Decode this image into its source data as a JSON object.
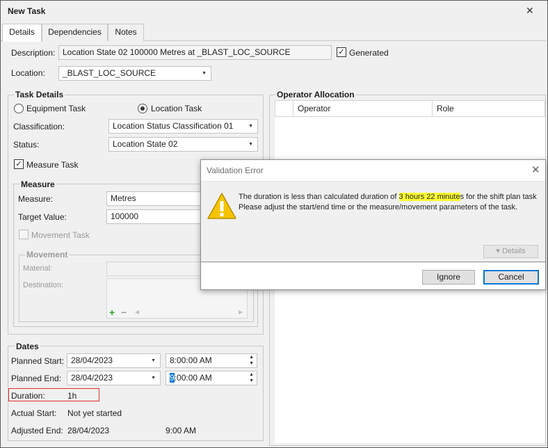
{
  "window": {
    "title": "New Task"
  },
  "tabs": [
    {
      "label": "Details"
    },
    {
      "label": "Dependencies"
    },
    {
      "label": "Notes"
    }
  ],
  "description": {
    "label": "Description:",
    "value": "Location State 02 100000 Metres at _BLAST_LOC_SOURCE",
    "generated_label": "Generated",
    "generated_checked": true
  },
  "location": {
    "label": "Location:",
    "value": "_BLAST_LOC_SOURCE"
  },
  "task_details": {
    "title": "Task Details",
    "equipment_task_label": "Equipment Task",
    "location_task_label": "Location Task",
    "selected": "location",
    "classification_label": "Classification:",
    "classification_value": "Location Status Classification 01",
    "status_label": "Status:",
    "status_value": "Location State 02",
    "measure_task_label": "Measure Task",
    "measure_task_checked": true
  },
  "measure": {
    "title": "Measure",
    "measure_label": "Measure:",
    "measure_value": "Metres",
    "target_label": "Target Value:",
    "target_value": "100000",
    "movement_task_label": "Movement Task"
  },
  "movement": {
    "title": "Movement",
    "material_label": "Material:",
    "destination_label": "Destination:",
    "add_glyph": "+",
    "remove_glyph": "−"
  },
  "dates": {
    "title": "Dates",
    "planned_start_label": "Planned Start:",
    "planned_start_date": "28/04/2023",
    "planned_start_time": "8:00:00 AM",
    "planned_end_label": "Planned End:",
    "planned_end_date": "28/04/2023",
    "planned_end_time_sel": "9",
    "planned_end_time_rest": ":00:00 AM",
    "duration_label": "Duration:",
    "duration_value": "1h",
    "actual_start_label": "Actual Start:",
    "actual_start_value": "Not yet started",
    "adjusted_end_label": "Adjusted End:",
    "adjusted_end_date": "28/04/2023",
    "adjusted_end_time": "9:00 AM"
  },
  "operator_allocation": {
    "title": "Operator Allocation",
    "columns": [
      "Operator",
      "Role"
    ]
  },
  "dialog": {
    "title": "Validation Error",
    "message_before": "The duration is less than calculated duration of ",
    "message_highlight": "3 hours 22 minute",
    "message_after": "s for the shift plan task",
    "message_line2": "Please adjust the start/end time or the measure/movement parameters of the task.",
    "details_label": "▾ Details",
    "ignore_label": "Ignore",
    "cancel_label": "Cancel"
  },
  "colors": {
    "highlight": "#ffff33",
    "warning_icon": "#f5c400",
    "duration_border": "#e03030",
    "default_button_border": "#0078d7"
  }
}
